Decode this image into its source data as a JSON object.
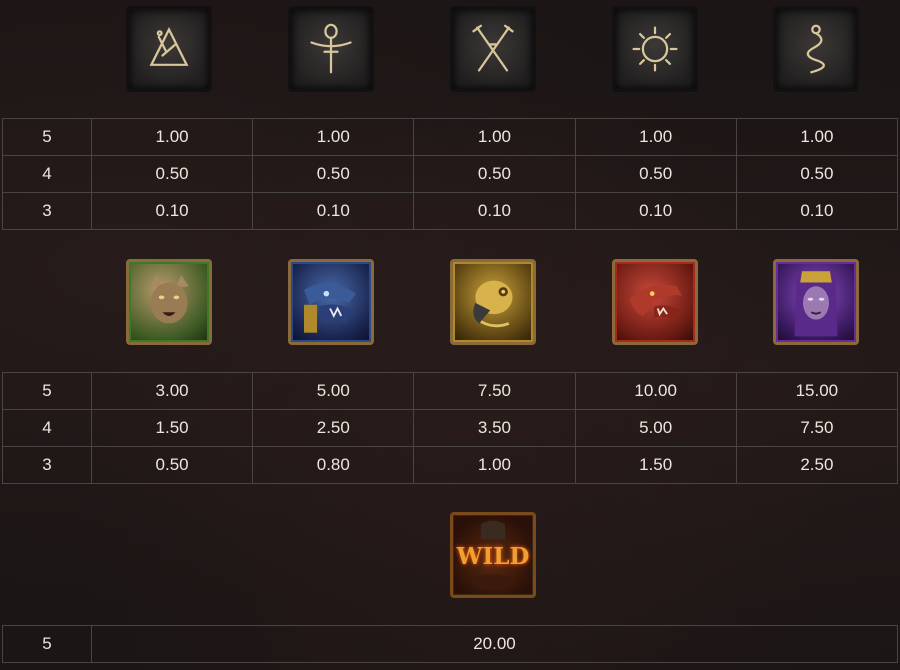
{
  "low_symbols": {
    "icons": [
      "triangle-rune-icon",
      "ankh-rune-icon",
      "crossed-spears-rune-icon",
      "sun-rune-icon",
      "serpent-rune-icon"
    ],
    "rows": [
      {
        "count": "5",
        "values": [
          "1.00",
          "1.00",
          "1.00",
          "1.00",
          "1.00"
        ]
      },
      {
        "count": "4",
        "values": [
          "0.50",
          "0.50",
          "0.50",
          "0.50",
          "0.50"
        ]
      },
      {
        "count": "3",
        "values": [
          "0.10",
          "0.10",
          "0.10",
          "0.10",
          "0.10"
        ]
      }
    ]
  },
  "high_symbols": {
    "icons": [
      "lynx-warrior-icon",
      "blue-dragon-icon",
      "golden-bird-warrior-icon",
      "red-dragon-icon",
      "purple-sorceress-icon"
    ],
    "frame_colors": [
      "#3c7a2a",
      "#2c4a8a",
      "#b08a2a",
      "#a82a1c",
      "#6a2a9a"
    ],
    "rows": [
      {
        "count": "5",
        "values": [
          "3.00",
          "5.00",
          "7.50",
          "10.00",
          "15.00"
        ]
      },
      {
        "count": "4",
        "values": [
          "1.50",
          "2.50",
          "3.50",
          "5.00",
          "7.50"
        ]
      },
      {
        "count": "3",
        "values": [
          "0.50",
          "0.80",
          "1.00",
          "1.50",
          "2.50"
        ]
      }
    ]
  },
  "wild_symbol": {
    "icon": "wild-icon",
    "label": "WILD",
    "rows": [
      {
        "count": "5",
        "value": "20.00"
      }
    ]
  }
}
